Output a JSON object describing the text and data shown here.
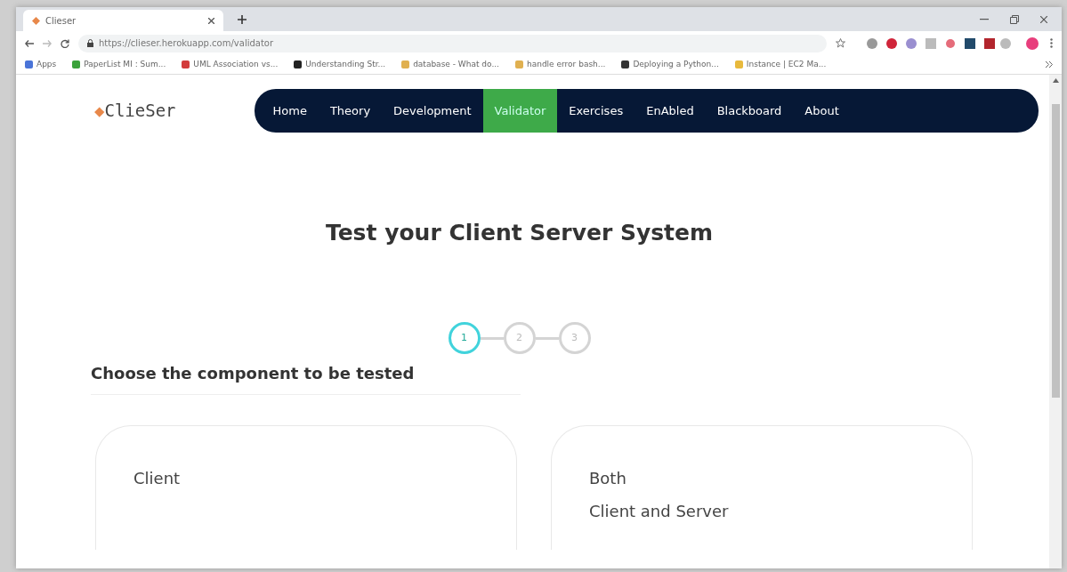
{
  "browser": {
    "tab_title": "Clieser",
    "url": "https://clieser.herokuapp.com/validator",
    "bookmarks": [
      {
        "label": "Apps",
        "color": "#4a74d8"
      },
      {
        "label": "PaperList MI : Sum...",
        "color": "#3aa23a"
      },
      {
        "label": "UML Association vs...",
        "color": "#d23b3b"
      },
      {
        "label": "Understanding Str...",
        "color": "#222222"
      },
      {
        "label": "database - What do...",
        "color": "#e0b050"
      },
      {
        "label": "handle error bash...",
        "color": "#e0b050"
      },
      {
        "label": "Deploying a Python...",
        "color": "#333333"
      },
      {
        "label": "Instance | EC2 Ma...",
        "color": "#e8b93c"
      }
    ]
  },
  "site": {
    "logo": "◆",
    "brand": "ClieSer",
    "nav": [
      {
        "label": "Home",
        "selected": false
      },
      {
        "label": "Theory",
        "selected": false
      },
      {
        "label": "Development",
        "selected": false
      },
      {
        "label": "Validator",
        "selected": true
      },
      {
        "label": "Exercises",
        "selected": false
      },
      {
        "label": "EnAbled",
        "selected": false
      },
      {
        "label": "Blackboard",
        "selected": false
      },
      {
        "label": "About",
        "selected": false
      }
    ]
  },
  "heading": "Test your Client Server System",
  "steps": [
    {
      "label": "1",
      "selected": true
    },
    {
      "label": "2",
      "selected": false
    },
    {
      "label": "3",
      "selected": false
    }
  ],
  "prompt": "Choose the component to be tested",
  "options": [
    {
      "lines": [
        "Client"
      ]
    },
    {
      "lines": [
        "Both",
        "Client and Server"
      ]
    }
  ]
}
